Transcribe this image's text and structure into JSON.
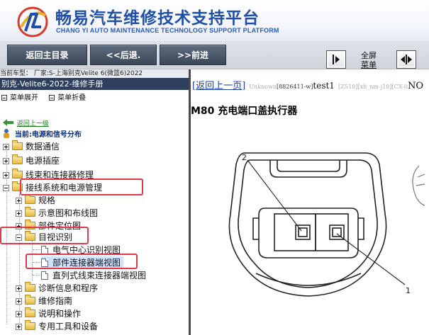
{
  "brand": {
    "title_cn": "畅易汽车维修技术支持平台",
    "title_en": "CHANG YI AUTO MAINTENANCE TECHNOLOGY SUPPORT PLATFORM"
  },
  "toolbar": {
    "home_label": "返回主目录",
    "back_label": "<<后退.",
    "forward_label": ">>前进",
    "fullscreen_label_1": "全屏",
    "fullscreen_label_2": "菜单"
  },
  "left": {
    "vehicle_info": "当前车型： 厂家:S-上海别克Velite 6(微蓝6)2022",
    "manual_title": "别克-Velite6-2022-维修手册",
    "expand_label": "菜单展开",
    "collapse_label": "菜单折叠",
    "back_up_label": "返回上一级",
    "current_label": "当前:电源和信号分布",
    "tree": [
      {
        "label": "数据通信"
      },
      {
        "label": "电源插座"
      },
      {
        "label": "线束和连接器修理"
      },
      {
        "label": "接线系统和电源管理"
      },
      {
        "label": "规格"
      },
      {
        "label": "示意图和布线图"
      },
      {
        "label": "部件定位图"
      },
      {
        "label": "目视识别"
      },
      {
        "label": "电气中心识别视图"
      },
      {
        "label": "部件连接器端视图"
      },
      {
        "label": "直列式线束连接器端视图"
      },
      {
        "label": "诊断信息和程序"
      },
      {
        "label": "维修指南"
      },
      {
        "label": "说明和操作"
      },
      {
        "label": "专用工具和设备"
      }
    ]
  },
  "content": {
    "prev_link": "[返回上一页]",
    "unknown_text": "Unknown",
    "code_text": "[8826411-w]",
    "test_text": "test1",
    "bracket_text": "[ZS18][xh_nm-j18][CX-0",
    "trailing_text": "NO",
    "title": "M80 充电端口盖执行器",
    "callout_1": "1",
    "callout_2": "2"
  },
  "colors": {
    "brand_blue": "#1f4fa8",
    "highlight_red": "#e0394b",
    "title_bar": "#2d3f5d"
  }
}
